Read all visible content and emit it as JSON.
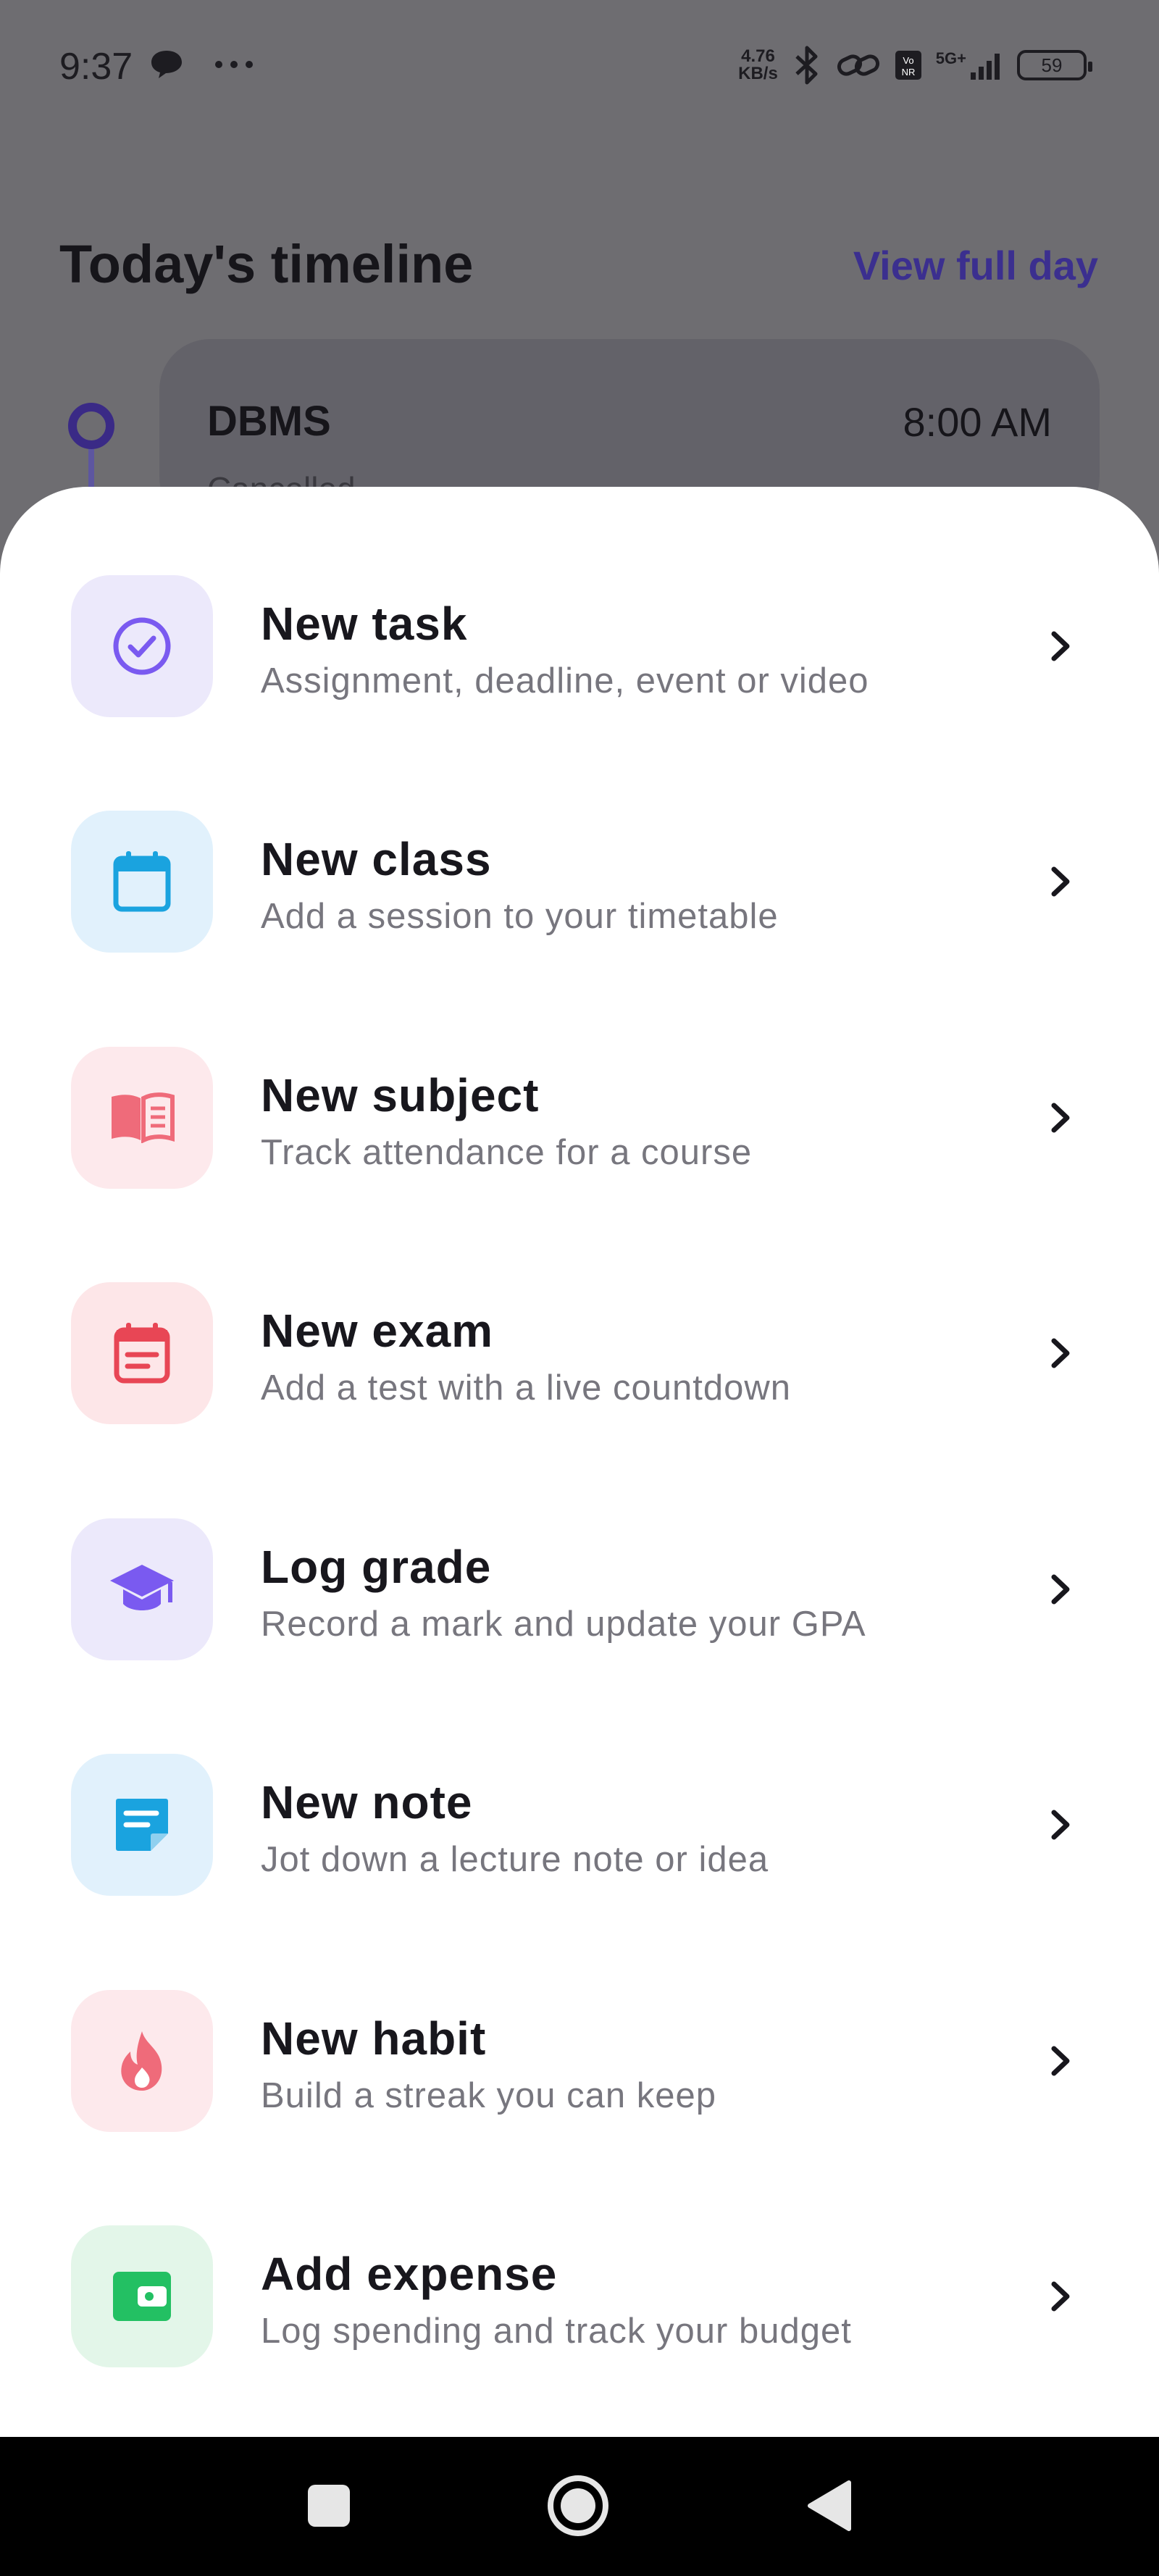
{
  "status_bar": {
    "time": "9:37",
    "net_speed_value": "4.76",
    "net_speed_unit": "KB/s",
    "network": "5G+",
    "battery": "59"
  },
  "background": {
    "title": "Today's timeline",
    "view_full_day": "View full day",
    "card": {
      "title": "DBMS",
      "time": "8:00 AM",
      "subtitle": "Cancelled"
    }
  },
  "actions": [
    {
      "title": "New task",
      "description": "Assignment, deadline, event or video",
      "icon": "check-circle-icon",
      "bg": "#ece9fb",
      "color": "#7a5af0"
    },
    {
      "title": "New class",
      "description": "Add a session to your timetable",
      "icon": "calendar-icon",
      "bg": "#e1f1fc",
      "color": "#1aa3df"
    },
    {
      "title": "New subject",
      "description": "Track attendance for a course",
      "icon": "book-open-icon",
      "bg": "#fde9ec",
      "color": "#ef6b7a"
    },
    {
      "title": "New exam",
      "description": "Add a test with a live countdown",
      "icon": "calendar-note-icon",
      "bg": "#fde6e8",
      "color": "#e84655"
    },
    {
      "title": "Log grade",
      "description": "Record a mark and update your GPA",
      "icon": "graduation-cap-icon",
      "bg": "#ece9fb",
      "color": "#7a5af0"
    },
    {
      "title": "New note",
      "description": "Jot down a lecture note or idea",
      "icon": "note-icon",
      "bg": "#e1f1fc",
      "color": "#1aa3df"
    },
    {
      "title": "New habit",
      "description": "Build a streak you can keep",
      "icon": "flame-icon",
      "bg": "#fde9ec",
      "color": "#ef6b7a"
    },
    {
      "title": "Add expense",
      "description": "Log spending and track your budget",
      "icon": "wallet-icon",
      "bg": "#e3f6e9",
      "color": "#23c063"
    }
  ]
}
